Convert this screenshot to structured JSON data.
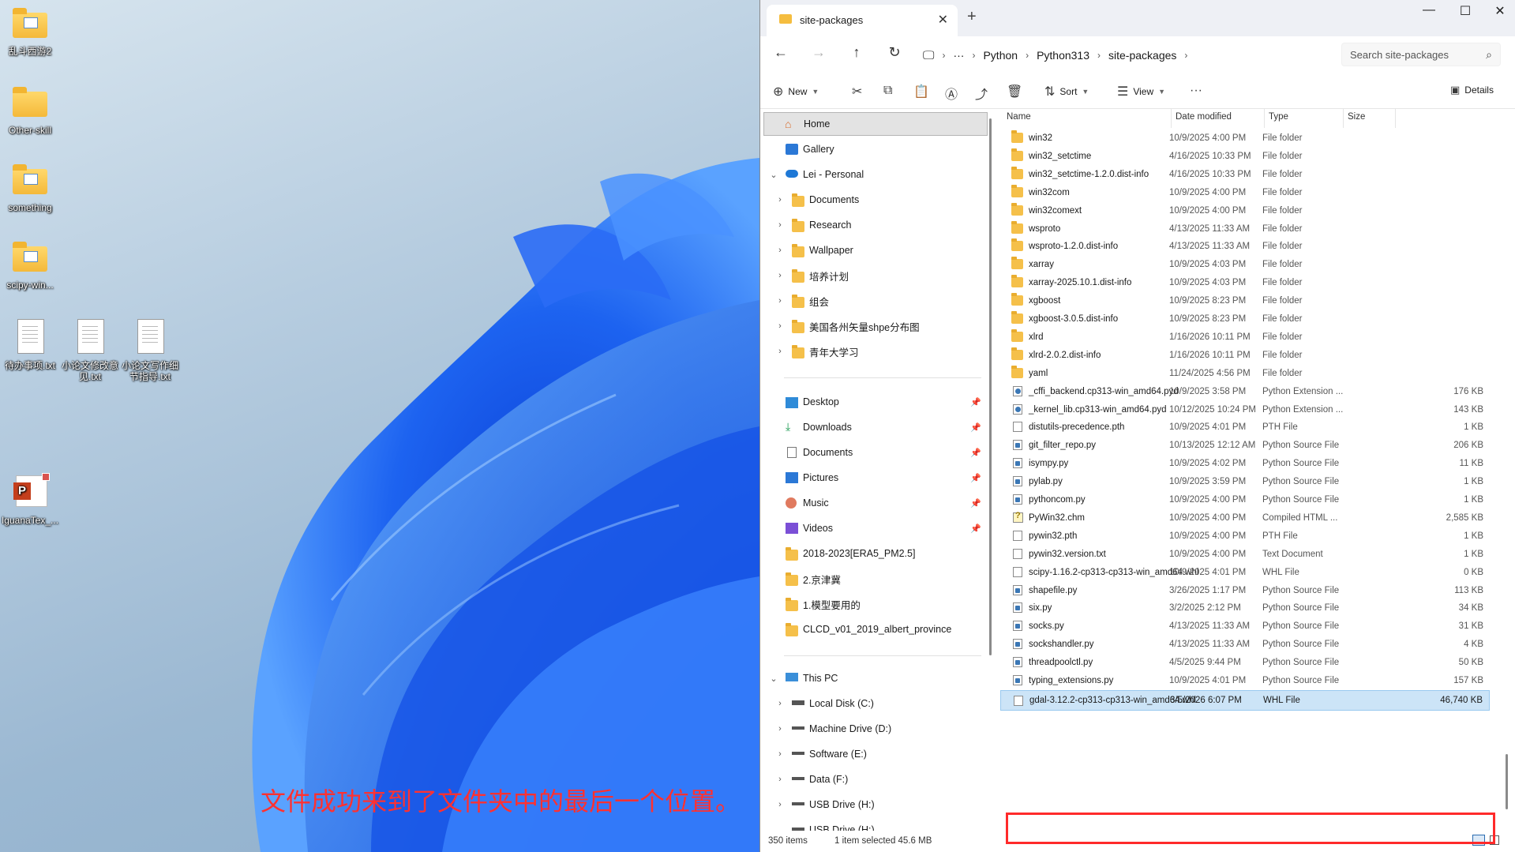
{
  "desktop": {
    "icons": [
      {
        "label": "乱斗西游2",
        "kind": "folder-special"
      },
      {
        "label": "Other-skill",
        "kind": "folder"
      },
      {
        "label": "something",
        "kind": "folder-special"
      },
      {
        "label": "scipy-win...",
        "kind": "folder-special"
      },
      {
        "label": "待办事项.txt",
        "kind": "file"
      },
      {
        "label": "小论文修改意见.txt",
        "kind": "file"
      },
      {
        "label": "小论文写作细节指导.txt",
        "kind": "file"
      },
      {
        "label": "IguanaTex_...",
        "kind": "ppt"
      }
    ],
    "caption": "文件成功来到了文件夹中的最后一个位置。",
    "caption_color": "#ff3131"
  },
  "window": {
    "tab_title": "site-packages",
    "tab_close_icon": "close-icon",
    "new_tab_icon": "plus-icon",
    "controls": {
      "minimize": "—",
      "maximize": "☐",
      "close": "✕"
    }
  },
  "address": {
    "back_icon": "arrow-left-icon",
    "forward_icon": "arrow-right-icon",
    "up_icon": "arrow-up-icon",
    "refresh_icon": "refresh-icon",
    "breadcrumb": [
      "Python",
      "Python313",
      "site-packages"
    ],
    "more_label": "···",
    "search_placeholder": "Search site-packages"
  },
  "commandbar": {
    "new_label": "New",
    "sort_label": "Sort",
    "view_label": "View",
    "more_label": "···",
    "details_label": "Details"
  },
  "nav": {
    "home": "Home",
    "gallery": "Gallery",
    "onedrive": "Lei - Personal",
    "onedrive_children": [
      "Documents",
      "Research",
      "Wallpaper",
      "培养计划",
      "组会",
      "美国各州矢量shpe分布图",
      "青年大学习"
    ],
    "quick_access": [
      {
        "label": "Desktop",
        "pinned": true
      },
      {
        "label": "Downloads",
        "pinned": true
      },
      {
        "label": "Documents",
        "pinned": true
      },
      {
        "label": "Pictures",
        "pinned": true
      },
      {
        "label": "Music",
        "pinned": true
      },
      {
        "label": "Videos",
        "pinned": true
      },
      {
        "label": "2018-2023[ERA5_PM2.5]",
        "pinned": false
      },
      {
        "label": "2.京津冀",
        "pinned": false
      },
      {
        "label": "1.模型要用的",
        "pinned": false
      },
      {
        "label": "CLCD_v01_2019_albert_province",
        "pinned": false
      }
    ],
    "this_pc": "This PC",
    "drives": [
      "Local Disk (C:)",
      "Machine Drive (D:)",
      "Software (E:)",
      "Data (F:)",
      "USB Drive (H:)",
      "USB Drive (H:)"
    ]
  },
  "columns": {
    "name": "Name",
    "date": "Date modified",
    "type": "Type",
    "size": "Size"
  },
  "files": [
    {
      "name": "win32",
      "date": "10/9/2025 4:00 PM",
      "type": "File folder",
      "size": "",
      "icon": "folder"
    },
    {
      "name": "win32_setctime",
      "date": "4/16/2025 10:33 PM",
      "type": "File folder",
      "size": "",
      "icon": "folder"
    },
    {
      "name": "win32_setctime-1.2.0.dist-info",
      "date": "4/16/2025 10:33 PM",
      "type": "File folder",
      "size": "",
      "icon": "folder"
    },
    {
      "name": "win32com",
      "date": "10/9/2025 4:00 PM",
      "type": "File folder",
      "size": "",
      "icon": "folder"
    },
    {
      "name": "win32comext",
      "date": "10/9/2025 4:00 PM",
      "type": "File folder",
      "size": "",
      "icon": "folder"
    },
    {
      "name": "wsproto",
      "date": "4/13/2025 11:33 AM",
      "type": "File folder",
      "size": "",
      "icon": "folder"
    },
    {
      "name": "wsproto-1.2.0.dist-info",
      "date": "4/13/2025 11:33 AM",
      "type": "File folder",
      "size": "",
      "icon": "folder"
    },
    {
      "name": "xarray",
      "date": "10/9/2025 4:03 PM",
      "type": "File folder",
      "size": "",
      "icon": "folder"
    },
    {
      "name": "xarray-2025.10.1.dist-info",
      "date": "10/9/2025 4:03 PM",
      "type": "File folder",
      "size": "",
      "icon": "folder"
    },
    {
      "name": "xgboost",
      "date": "10/9/2025 8:23 PM",
      "type": "File folder",
      "size": "",
      "icon": "folder"
    },
    {
      "name": "xgboost-3.0.5.dist-info",
      "date": "10/9/2025 8:23 PM",
      "type": "File folder",
      "size": "",
      "icon": "folder"
    },
    {
      "name": "xlrd",
      "date": "1/16/2026 10:11 PM",
      "type": "File folder",
      "size": "",
      "icon": "folder"
    },
    {
      "name": "xlrd-2.0.2.dist-info",
      "date": "1/16/2026 10:11 PM",
      "type": "File folder",
      "size": "",
      "icon": "folder"
    },
    {
      "name": "yaml",
      "date": "11/24/2025 4:56 PM",
      "type": "File folder",
      "size": "",
      "icon": "folder"
    },
    {
      "name": "_cffi_backend.cp313-win_amd64.pyd",
      "date": "10/9/2025 3:58 PM",
      "type": "Python Extension ...",
      "size": "176 KB",
      "icon": "pyd"
    },
    {
      "name": "_kernel_lib.cp313-win_amd64.pyd",
      "date": "10/12/2025 10:24 PM",
      "type": "Python Extension ...",
      "size": "143 KB",
      "icon": "pyd"
    },
    {
      "name": "distutils-precedence.pth",
      "date": "10/9/2025 4:01 PM",
      "type": "PTH File",
      "size": "1 KB",
      "icon": "doc"
    },
    {
      "name": "git_filter_repo.py",
      "date": "10/13/2025 12:12 AM",
      "type": "Python Source File",
      "size": "206 KB",
      "icon": "py"
    },
    {
      "name": "isympy.py",
      "date": "10/9/2025 4:02 PM",
      "type": "Python Source File",
      "size": "11 KB",
      "icon": "py"
    },
    {
      "name": "pylab.py",
      "date": "10/9/2025 3:59 PM",
      "type": "Python Source File",
      "size": "1 KB",
      "icon": "py"
    },
    {
      "name": "pythoncom.py",
      "date": "10/9/2025 4:00 PM",
      "type": "Python Source File",
      "size": "1 KB",
      "icon": "py"
    },
    {
      "name": "PyWin32.chm",
      "date": "10/9/2025 4:00 PM",
      "type": "Compiled HTML ...",
      "size": "2,585 KB",
      "icon": "chm"
    },
    {
      "name": "pywin32.pth",
      "date": "10/9/2025 4:00 PM",
      "type": "PTH File",
      "size": "1 KB",
      "icon": "doc"
    },
    {
      "name": "pywin32.version.txt",
      "date": "10/9/2025 4:00 PM",
      "type": "Text Document",
      "size": "1 KB",
      "icon": "doc"
    },
    {
      "name": "scipy-1.16.2-cp313-cp313-win_amd64.whl",
      "date": "10/9/2025 4:01 PM",
      "type": "WHL File",
      "size": "0 KB",
      "icon": "doc"
    },
    {
      "name": "shapefile.py",
      "date": "3/26/2025 1:17 PM",
      "type": "Python Source File",
      "size": "113 KB",
      "icon": "py"
    },
    {
      "name": "six.py",
      "date": "3/2/2025 2:12 PM",
      "type": "Python Source File",
      "size": "34 KB",
      "icon": "py"
    },
    {
      "name": "socks.py",
      "date": "4/13/2025 11:33 AM",
      "type": "Python Source File",
      "size": "31 KB",
      "icon": "py"
    },
    {
      "name": "sockshandler.py",
      "date": "4/13/2025 11:33 AM",
      "type": "Python Source File",
      "size": "4 KB",
      "icon": "py"
    },
    {
      "name": "threadpoolctl.py",
      "date": "4/5/2025 9:44 PM",
      "type": "Python Source File",
      "size": "50 KB",
      "icon": "py"
    },
    {
      "name": "typing_extensions.py",
      "date": "10/9/2025 4:01 PM",
      "type": "Python Source File",
      "size": "157 KB",
      "icon": "py"
    },
    {
      "name": "gdal-3.12.2-cp313-cp313-win_amd64.whl",
      "date": "3/5/2026 6:07 PM",
      "type": "WHL File",
      "size": "46,740 KB",
      "icon": "doc",
      "selected": true
    }
  ],
  "status": {
    "items": "350 items",
    "selected": "1 item selected  45.6 MB"
  },
  "colors": {
    "highlight_box": "#ff2a2a",
    "selection_bg": "#cce4f7",
    "folder": "#f5c04a"
  }
}
